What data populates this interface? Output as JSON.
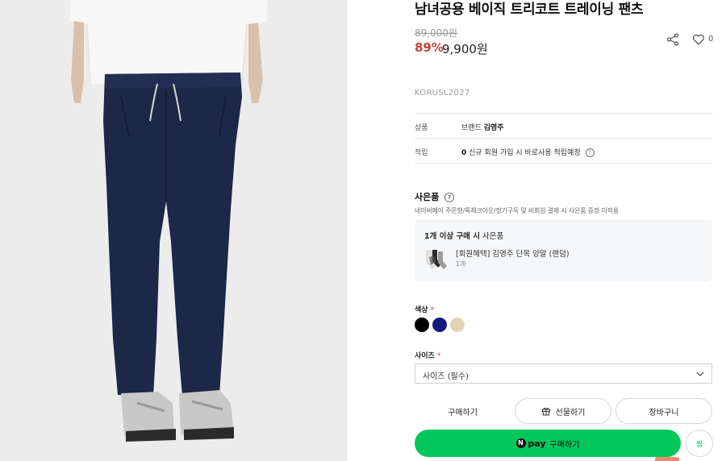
{
  "product": {
    "title": "남녀공용 베이직 트리코트 트레이닝 팬츠",
    "original_price": "89,000원",
    "discount": "89%",
    "price": "9,900원",
    "like_count": "0",
    "sku": "KORUSL2027"
  },
  "info": {
    "rows": [
      {
        "label": "상품",
        "value_prefix": "브랜드",
        "value_bold": "김영주",
        "value_rest": ""
      },
      {
        "label": "적립",
        "value_prefix": "",
        "value_bold": "0",
        "value_rest": "신규 회원 가입 시 바로사용 적립예정"
      }
    ]
  },
  "gift": {
    "title": "사은품",
    "subtitle": "네이버페이 주문형/톡체크아웃/정기구독 및 비회원 결제 시 사은품 증정 미적용",
    "condition_bold": "1개 이상 구매 시",
    "condition_rest": "사은품",
    "item_name": "[회원혜택] 김영주 단목 양말 (랜덤)",
    "item_qty": "1개"
  },
  "options": {
    "color_label": "색상",
    "required_mark": "*",
    "colors": [
      "#000000",
      "#0f1a7a",
      "#e2d3b6"
    ],
    "size_label": "사이즈",
    "size_placeholder": "사이즈 (필수)"
  },
  "buttons": {
    "buy": "구매하기",
    "gift": "선물하기",
    "cart": "장바구니",
    "npay_badge": "N",
    "npay_word": "pay",
    "npay_label": "구매하기",
    "zzim": "찜"
  },
  "icons": {
    "share": "share-icon",
    "like": "heart-icon",
    "help": "question-circle-icon",
    "dropdown": "chevron-down-icon",
    "gift": "gift-icon"
  },
  "colors": {
    "accent_red": "#c8443a",
    "npay_green": "#03c75a"
  }
}
